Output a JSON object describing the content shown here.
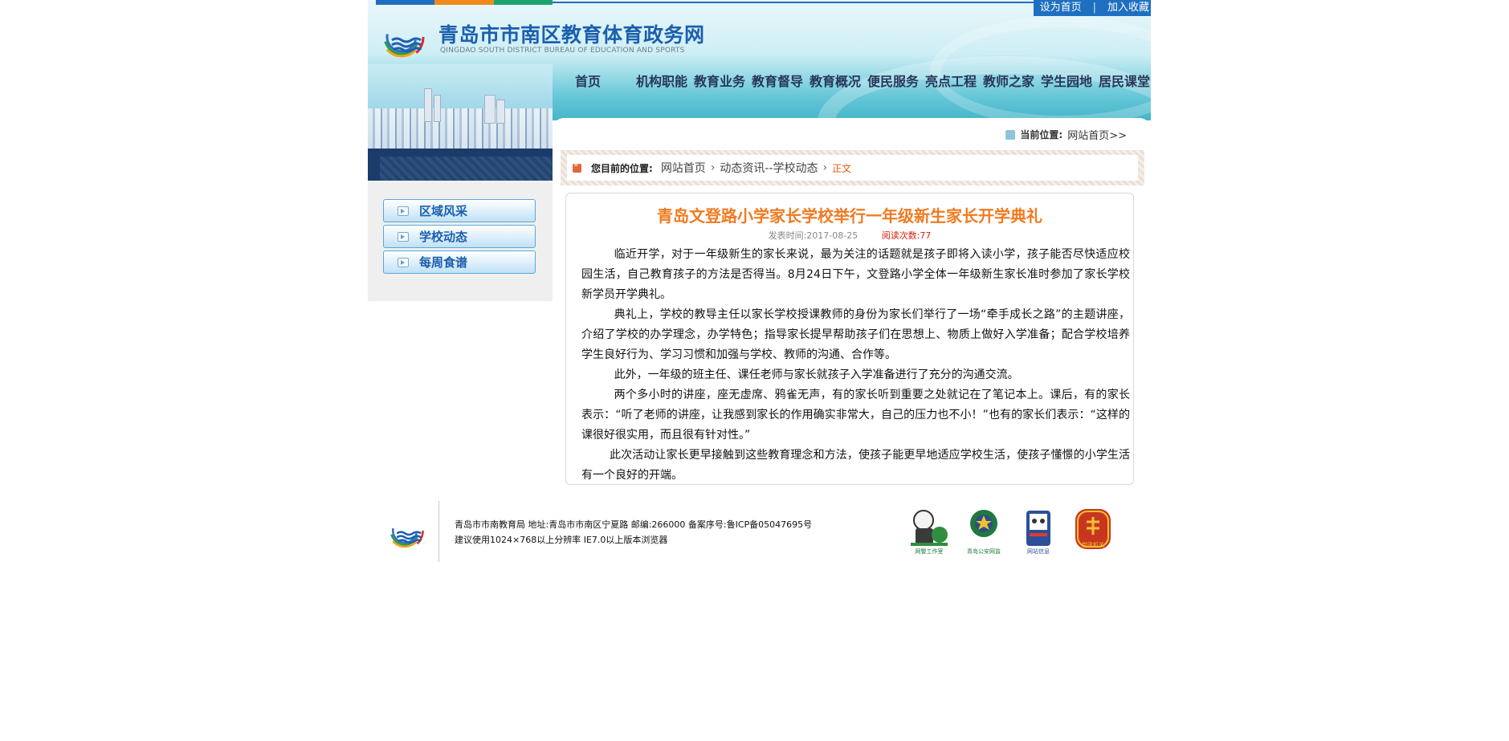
{
  "top_links": [
    "设为首页",
    "|",
    "加入收藏"
  ],
  "site": {
    "title": "青岛市市南区教育体育政务网",
    "subtitle": "QINGDAO SOUTH DISTRICT BUREAU OF EDUCATION AND SPORTS"
  },
  "nav": [
    "首页",
    "机构职能",
    "教育业务",
    "教育督导",
    "教育概况",
    "便民服务",
    "亮点工程",
    "教师之家",
    "学生园地",
    "居民课堂"
  ],
  "location": {
    "label": "当前位置:",
    "value": "网站首页>>"
  },
  "sidebar": [
    "区域风采",
    "学校动态",
    "每周食谱"
  ],
  "crumb": {
    "label": "您目前的位置:",
    "home": "网站首页",
    "section": "动态资讯--学校动态",
    "current": "正文"
  },
  "article": {
    "title": "青岛文登路小学家长学校举行一年级新生家长开学典礼",
    "date": "发表时间:2017-08-25",
    "views": "阅读次数:77",
    "paragraphs": [
      "临近开学，对于一年级新生的家长来说，最为关注的话题就是孩子即将入读小学，孩子能否尽快适应校园生活，自己教育孩子的方法是否得当。8月24日下午，文登路小学全体一年级新生家长准时参加了家长学校新学员开学典礼。",
      "典礼上，学校的教导主任以家长学校授课教师的身份为家长们举行了一场“牵手成长之路”的主题讲座，介绍了学校的办学理念，办学特色；指导家长提早帮助孩子们在思想上、物质上做好入学准备；配合学校培养学生良好行为、学习习惯和加强与学校、教师的沟通、合作等。",
      "此外，一年级的班主任、课任老师与家长就孩子入学准备进行了充分的沟通交流。",
      "两个多小时的讲座，座无虚席、鸦雀无声，有的家长听到重要之处就记在了笔记本上。课后，有的家长表示：“听了老师的讲座，让我感到家长的作用确实非常大，自己的压力也不小！”也有的家长们表示：“这样的课很好很实用，而且很有针对性。”",
      "此次活动让家长更早接触到这些教育理念和方法，使孩子能更早地适应学校生活，使孩子懂憬的小学生活有一个良好的开端。"
    ]
  },
  "footer": {
    "line1": "青岛市市南教育局 地址:青岛市市南区宁夏路 邮编:266000 备案序号:鲁ICP备05047695号",
    "line2": "建议使用1024×768以上分辨率 IE7.0以上版本浏览器",
    "badges": [
      "网警工作室",
      "青岛公安网监",
      "网站信息",
      "党政机关"
    ]
  },
  "colors": {
    "brand_blue": "#1b5fae",
    "accent_orange": "#f07a20",
    "views_red": "#d9200f"
  }
}
